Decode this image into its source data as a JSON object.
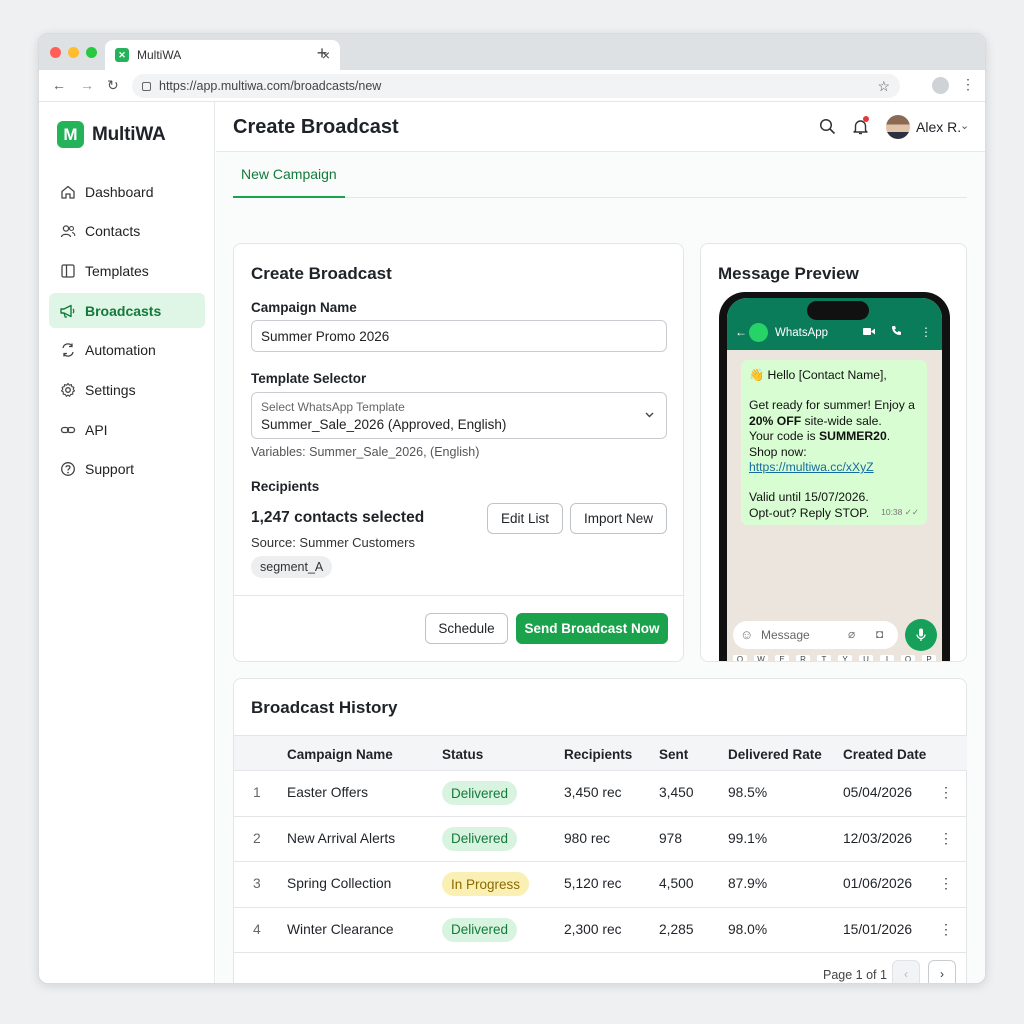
{
  "browser": {
    "tab_title": "MultiWA",
    "tab_close": "×",
    "new_tab": "+",
    "url": "https://app.multiwa.com/broadcasts/new",
    "back": "←",
    "forward": "→",
    "reload": "↻",
    "star": "☆",
    "menu": "⋮"
  },
  "sidebar": {
    "brand": "MultiWA",
    "items": [
      {
        "label": "Dashboard",
        "icon": "home-icon"
      },
      {
        "label": "Contacts",
        "icon": "contacts-icon"
      },
      {
        "label": "Templates",
        "icon": "templates-icon"
      },
      {
        "label": "Broadcasts",
        "icon": "megaphone-icon",
        "active": true
      },
      {
        "label": "Automation",
        "icon": "automation-icon"
      },
      {
        "label": "Settings",
        "icon": "gear-icon"
      },
      {
        "label": "API",
        "icon": "link-icon"
      },
      {
        "label": "Support",
        "icon": "help-icon"
      }
    ]
  },
  "header": {
    "title": "Create Broadcast",
    "user_name": "Alex R.",
    "user_chevron": "⌄"
  },
  "tabs": {
    "active": "New Campaign"
  },
  "form": {
    "title": "Create Broadcast",
    "campaign_label": "Campaign Name",
    "campaign_value": "Summer Promo 2026",
    "template_label": "Template Selector",
    "template_placeholder": "Select WhatsApp Template",
    "template_value": "Summer_Sale_2026 (Approved, English)",
    "template_vars": "Variables: Summer_Sale_2026, (English)",
    "recipients_label": "Recipients",
    "recipients_count": "1,247 contacts selected",
    "recipients_source": "Source: Summer Customers",
    "segment_chip": "segment_A",
    "edit_list": "Edit List",
    "import_new": "Import New",
    "schedule": "Schedule",
    "send_now": "Send Broadcast Now"
  },
  "preview": {
    "title": "Message Preview",
    "chat_name": "WhatsApp",
    "line1": "👋 Hello [Contact Name],",
    "line2": "Get ready for summer! Enjoy a",
    "line3_bold": "20% OFF",
    "line3_rest": " site-wide sale.",
    "line4_pre": "Your code is ",
    "line4_bold": "SUMMER20",
    "line4_post": ".",
    "line5": "Shop now:",
    "link": "https://multiwa.cc/xXyZ",
    "line6": "Valid until 15/07/2026.",
    "line7": "Opt-out? Reply STOP.",
    "time": "10:38 ✓✓",
    "input_placeholder": "Message",
    "keys": [
      "Q",
      "W",
      "E",
      "R",
      "T",
      "Y",
      "U",
      "I",
      "O",
      "P"
    ]
  },
  "history": {
    "title": "Broadcast History",
    "columns": [
      "Campaign Name",
      "Status",
      "Recipients",
      "Sent",
      "Delivered Rate",
      "Created Date"
    ],
    "rows": [
      {
        "idx": "1",
        "name": "Easter Offers",
        "status": "Delivered",
        "status_color": "#d8f3df",
        "recipients": "3,450 rec",
        "sent": "3,450",
        "rate": "98.5%",
        "date": "05/04/2026"
      },
      {
        "idx": "2",
        "name": "New Arrival Alerts",
        "status": "Delivered",
        "status_color": "#d8f3df",
        "recipients": "980 rec",
        "sent": "978",
        "rate": "99.1%",
        "date": "12/03/2026"
      },
      {
        "idx": "3",
        "name": "Spring Collection",
        "status": "In Progress",
        "status_color": "#fbf0b4",
        "recipients": "5,120 rec",
        "sent": "4,500",
        "rate": "87.9%",
        "date": "01/06/2026"
      },
      {
        "idx": "4",
        "name": "Winter Clearance",
        "status": "Delivered",
        "status_color": "#d8f3df",
        "recipients": "2,300 rec",
        "sent": "2,285",
        "rate": "98.0%",
        "date": "15/01/2026"
      }
    ],
    "kebab": "⋮",
    "pager": "Page 1 of 1",
    "prev": "‹",
    "next": "›"
  }
}
